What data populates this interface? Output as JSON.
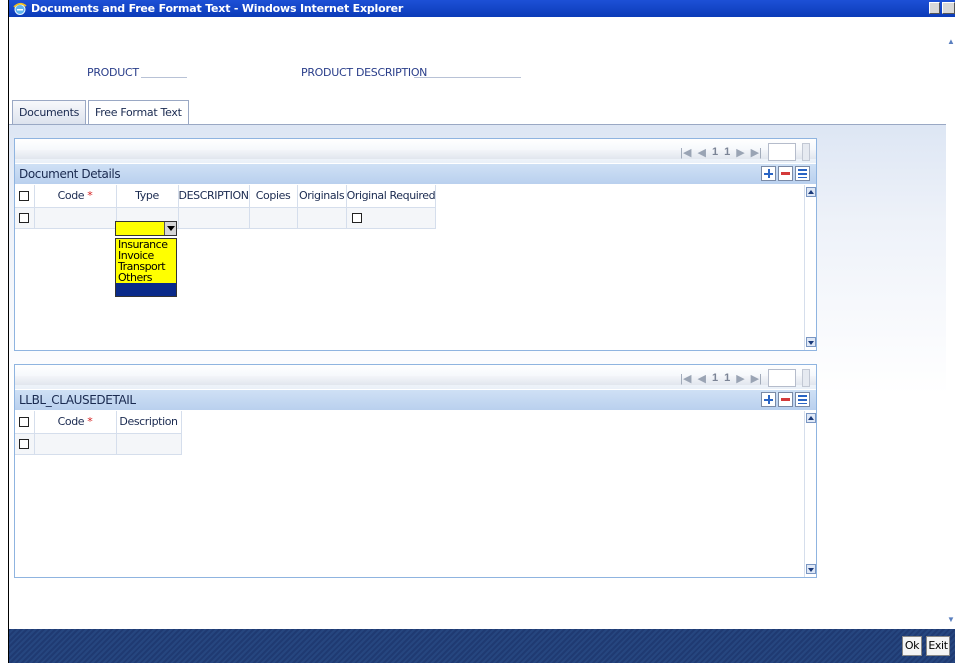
{
  "window": {
    "title": "Documents and Free Format Text - Windows Internet Explorer"
  },
  "header": {
    "product_label": "PRODUCT",
    "product_value": "",
    "product_description_label": "PRODUCT DESCRIPTION",
    "product_description_value": ""
  },
  "tabs": [
    {
      "label": "Documents",
      "active": false
    },
    {
      "label": "Free Format Text",
      "active": true
    }
  ],
  "document_details": {
    "title": "Document Details",
    "pager": {
      "first": "1",
      "last": "1"
    },
    "columns": [
      "Code",
      "Type",
      "DESCRIPTION",
      "Copies",
      "Originals",
      "Original Required"
    ],
    "required_marker": "*",
    "type_options": [
      "Insurance",
      "Invoice",
      "Transport",
      "Others",
      ""
    ]
  },
  "clause_details": {
    "title": "LLBL_CLAUSEDETAIL",
    "pager": {
      "first": "1",
      "last": "1"
    },
    "columns": [
      "Code",
      "Description"
    ],
    "required_marker": "*"
  },
  "footer": {
    "ok_label": "Ok",
    "exit_label": "Exit"
  },
  "colors": {
    "title_bar": "#0b3bb8",
    "dropdown_highlight": "#ffff00",
    "section_header": "#b9d0ee",
    "footer_bar": "#1f3a72"
  }
}
